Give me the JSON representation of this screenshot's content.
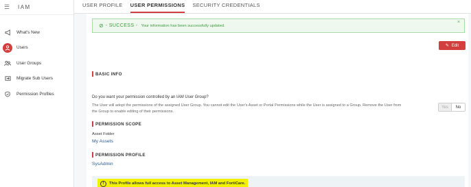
{
  "app": {
    "title": "IAM"
  },
  "sidebar": {
    "items": [
      {
        "label": "What's New",
        "icon": "megaphone-icon",
        "active": false
      },
      {
        "label": "Users",
        "icon": "user-icon",
        "active": true
      },
      {
        "label": "User Groups",
        "icon": "user-group-icon",
        "active": false
      },
      {
        "label": "Migrate Sub Users",
        "icon": "migrate-icon",
        "active": false
      },
      {
        "label": "Permission Profiles",
        "icon": "shield-icon",
        "active": false
      }
    ]
  },
  "tabs": [
    {
      "label": "USER PROFILE",
      "active": false
    },
    {
      "label": "USER PERMISSIONS",
      "active": true
    },
    {
      "label": "SECURITY CREDENTIALS",
      "active": false
    }
  ],
  "alert": {
    "label": "- SUCCESS -",
    "message": "Your information has been successfully updated.",
    "close": "×"
  },
  "edit_button": {
    "label": "Edit"
  },
  "basic_info": {
    "heading": "BASIC INFO",
    "question": "Do you want your permission controlled by an IAM User Group?",
    "description": "The User will adopt the permissions of the assigned User Group. You cannot edit the User's Asset or Portal Permissions while the User is assigned to a Group. Remove the User from the Group to enable editing of their permissions.",
    "toggle": {
      "yes": "Yes",
      "no": "No",
      "selected": "No"
    }
  },
  "permission_scope": {
    "heading": "PERMISSION SCOPE",
    "field_label": "Asset Folder",
    "value": "My Assets"
  },
  "permission_profile": {
    "heading": "PERMISSION PROFILE",
    "value": "SysAdmin"
  },
  "notice": {
    "text": "This Profile allows full access to Asset Management, IAM and FortiCare."
  },
  "colors": {
    "accent": "#d23f3f",
    "success": "#3c9a3c",
    "link": "#2a5a90",
    "highlight": "#f2f200"
  }
}
